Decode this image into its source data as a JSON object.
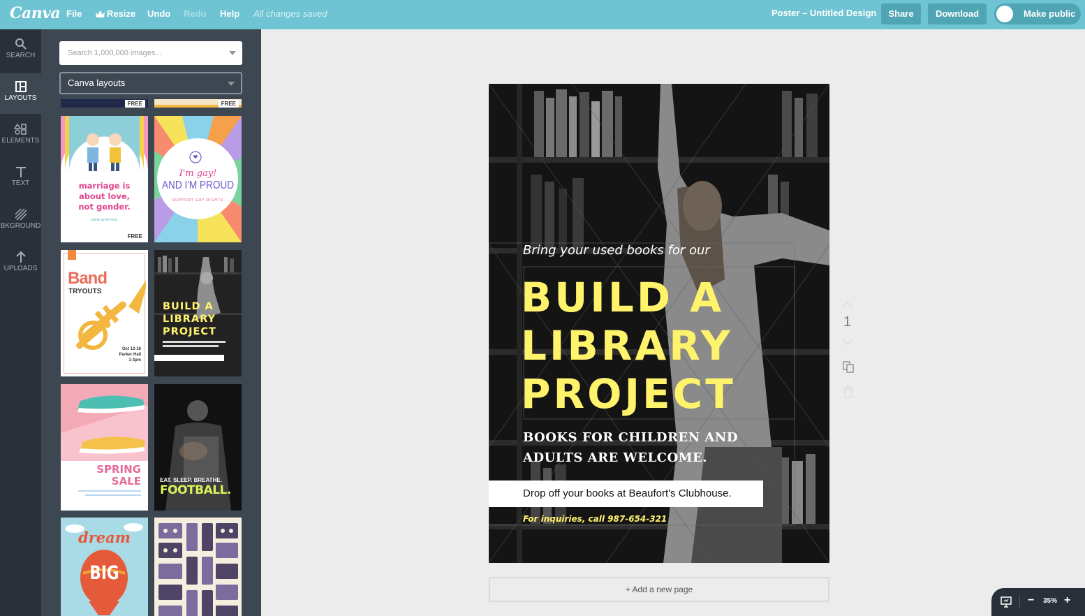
{
  "app": {
    "logo": "Canva"
  },
  "menu": {
    "file": "File",
    "resize": "Resize",
    "undo": "Undo",
    "redo": "Redo",
    "help": "Help",
    "saved_status": "All changes saved"
  },
  "header": {
    "doc_title": "Poster – Untitled Design",
    "share": "Share",
    "download": "Download",
    "make_public": "Make public"
  },
  "sidebar": {
    "items": [
      {
        "label": "SEARCH",
        "icon": "search-icon"
      },
      {
        "label": "LAYOUTS",
        "icon": "layouts-icon",
        "active": true
      },
      {
        "label": "ELEMENTS",
        "icon": "elements-icon"
      },
      {
        "label": "TEXT",
        "icon": "text-icon"
      },
      {
        "label": "BKGROUND",
        "icon": "background-icon"
      },
      {
        "label": "UPLOADS",
        "icon": "upload-icon"
      }
    ]
  },
  "panel": {
    "search_placeholder": "Search 1,000,000 images...",
    "layout_select": "Canva layouts",
    "free_label": "FREE",
    "thumbnails": {
      "marriage": {
        "text1": "marriage is",
        "text2": "about love,",
        "text3": "not gender.",
        "small": "stand up for love.",
        "free": "FREE"
      },
      "proud": {
        "script": "I'm gay!",
        "main": "AND I'M PROUD",
        "small": "SUPPORT GAY RIGHTS"
      },
      "band": {
        "title": "Band",
        "sub": "TRYOUTS",
        "date1": "Oct 12-16",
        "date2": "Parker Hall",
        "date3": "1-3pm"
      },
      "library": {
        "l1": "BUILD A",
        "l2": "LIBRARY",
        "l3": "PROJECT"
      },
      "spring": {
        "l1": "SPRING",
        "l2": "SALE"
      },
      "football": {
        "l1": "EAT. SLEEP. BREATHE.",
        "l2": "FOOTBALL."
      },
      "dream": {
        "l1": "dream",
        "l2": "BIG"
      }
    }
  },
  "poster": {
    "tagline": "Bring your used books for our",
    "headline1": "BUILD A",
    "headline2": "LIBRARY",
    "headline3": "PROJECT",
    "sub1": "BOOKS FOR CHILDREN AND",
    "sub2": "ADULTS ARE WELCOME.",
    "dropoff": "Drop off your books at Beaufort's Clubhouse.",
    "inquiries": "For inquiries, call 987-654-321"
  },
  "canvas": {
    "page_number": "1",
    "add_page": "+ Add a new page"
  },
  "zoom": {
    "level": "35%",
    "minus": "−",
    "plus": "+"
  },
  "colors": {
    "topbar": "#6ec4d2",
    "sidebar": "#293039",
    "panel": "#3d4752",
    "headline": "#fff36b"
  }
}
